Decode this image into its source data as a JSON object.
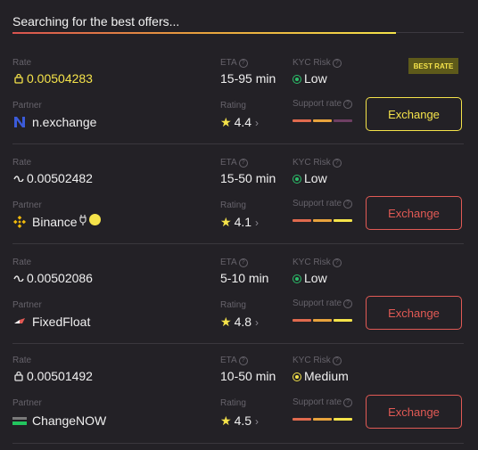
{
  "status_text": "Searching for the best offers...",
  "progress": 0.85,
  "labels": {
    "rate": "Rate",
    "partner": "Partner",
    "eta": "ETA",
    "rating": "Rating",
    "kyc": "KYC Risk",
    "support": "Support rate"
  },
  "badge": "BEST RATE",
  "colors": {
    "accent": "#f5e34a",
    "button_red": "#e25a55",
    "kyc_low": "#2bbf6a",
    "kyc_medium": "#f5e34a"
  },
  "offers": [
    {
      "rate_icon": "lock-icon",
      "rate": "0.00504283",
      "partner": "n.exchange",
      "partner_logo": "n-exchange-logo",
      "eta": "15-95 min",
      "rating": "4.4",
      "kyc": "Low",
      "support_level": 3,
      "button": "Exchange",
      "best": true
    },
    {
      "rate_icon": "float-icon",
      "rate": "0.00502482",
      "partner": "Binance",
      "partner_logo": "binance-logo",
      "eta": "15-50 min",
      "rating": "4.1",
      "kyc": "Low",
      "support_level": 4,
      "button": "Exchange",
      "best": false
    },
    {
      "rate_icon": "float-icon",
      "rate": "0.00502086",
      "partner": "FixedFloat",
      "partner_logo": "fixedfloat-logo",
      "eta": "5-10 min",
      "rating": "4.8",
      "kyc": "Low",
      "support_level": 4,
      "button": "Exchange",
      "best": false
    },
    {
      "rate_icon": "lock-icon",
      "rate": "0.00501492",
      "partner": "ChangeNOW",
      "partner_logo": "changenow-logo",
      "eta": "10-50 min",
      "rating": "4.5",
      "kyc": "Medium",
      "support_level": 4,
      "button": "Exchange",
      "best": false
    }
  ]
}
